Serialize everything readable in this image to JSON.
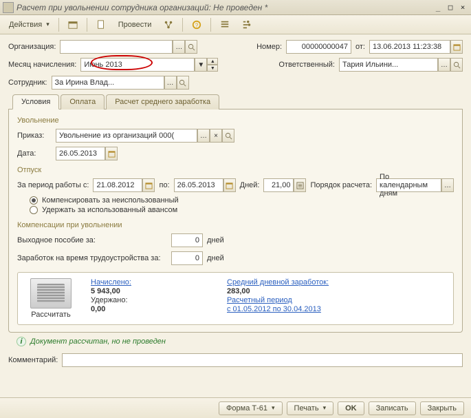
{
  "window": {
    "title": "Расчет при увольнении сотрудника организаций: Не проведен *"
  },
  "toolbar": {
    "actions": "Действия",
    "post": "Провести"
  },
  "header": {
    "org_label": "Организация:",
    "org_value": "",
    "month_label": "Месяц начисления:",
    "month_value": "Июнь 2013",
    "employee_label": "Сотрудник:",
    "employee_value": "За Ирина Влад...",
    "number_label": "Номер:",
    "number_value": "00000000047",
    "from_label": "от:",
    "date_value": "13.06.2013 11:23:38",
    "responsible_label": "Ответственный:",
    "responsible_value": "Тария Ильини..."
  },
  "tabs": {
    "t1": "Условия",
    "t2": "Оплата",
    "t3": "Расчет среднего заработка"
  },
  "dismissal": {
    "section": "Увольнение",
    "order_label": "Приказ:",
    "order_value": "Увольнение из организаций 000(",
    "date_label": "Дата:",
    "date_value": "26.05.2013"
  },
  "vacation": {
    "section": "Отпуск",
    "period_label": "За период работы с:",
    "period_from": "21.08.2012",
    "to_label": "по:",
    "period_to": "26.05.2013",
    "days_label": "Дней:",
    "days_value": "21,00",
    "method_label": "Порядок расчета:",
    "method_value": "По календарным дням",
    "radio1": "Компенсировать за неиспользованный",
    "radio2": "Удержать за использованный авансом"
  },
  "compensation": {
    "section": "Компенсации при увольнении",
    "severance_label": "Выходное пособие за:",
    "severance_value": "0",
    "days_word": "дней",
    "job_label": "Заработок на время трудоустройства за:",
    "job_value": "0"
  },
  "summary": {
    "calc_btn": "Рассчитать",
    "accrued_label": "Начислено:",
    "accrued_value": "5 943,00",
    "withheld_label": "Удержано:",
    "withheld_value": "0,00",
    "avg_label": "Средний дневной заработок:",
    "avg_value": "283,00",
    "period_label": "Расчетный период",
    "period_value": "с 01.05.2012 по 30.04.2013"
  },
  "status": "Документ рассчитан, но не проведен",
  "comment_label": "Комментарий:",
  "footer": {
    "t61": "Форма Т-61",
    "print": "Печать",
    "ok": "OK",
    "save": "Записать",
    "close": "Закрыть"
  }
}
